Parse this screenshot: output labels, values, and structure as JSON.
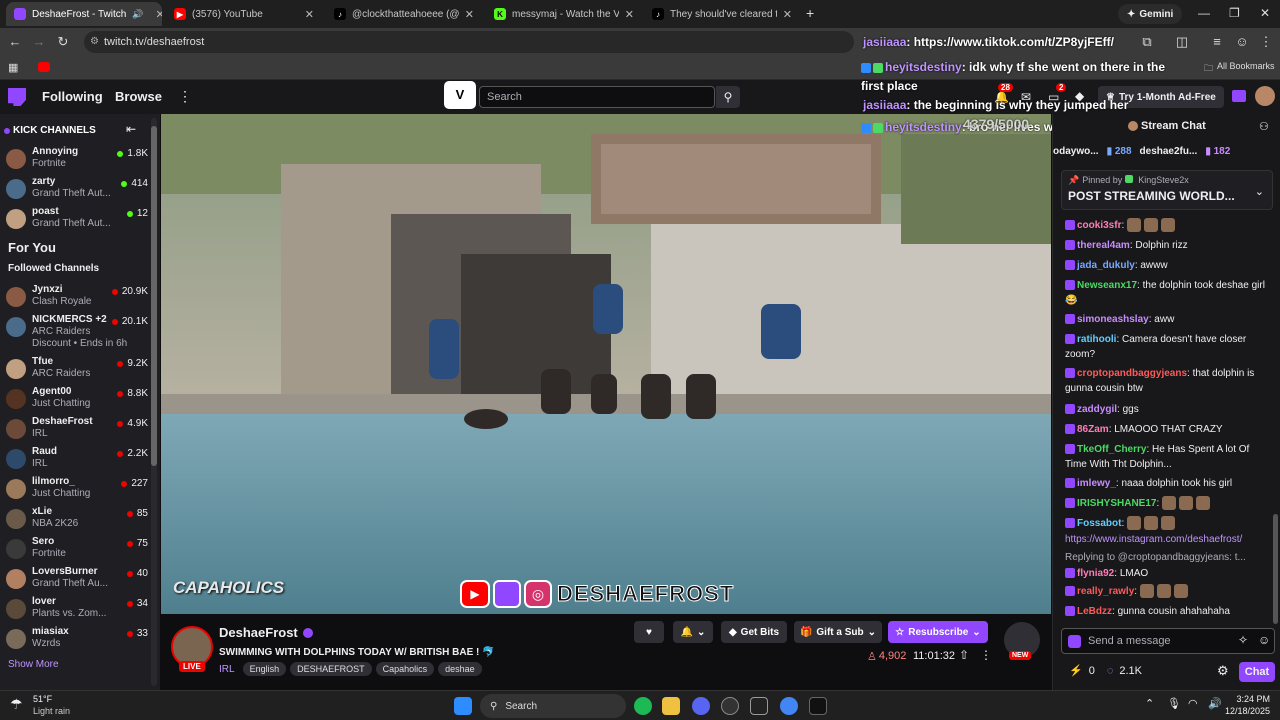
{
  "browser": {
    "tabs": [
      {
        "title": "DeshaeFrost - Twitch",
        "active": true
      },
      {
        "title": "(3576) YouTube"
      },
      {
        "title": "@clockthatteahoeee (@clockth"
      },
      {
        "title": "messymaj - Watch the VOD on"
      },
      {
        "title": "They should've cleared the hou"
      }
    ],
    "url": "twitch.tv/deshaefrost",
    "gemini_label": "Gemini",
    "all_bookmarks": "All Bookmarks"
  },
  "twitch_nav": {
    "following": "Following",
    "browse": "Browse",
    "search_placeholder": "Search",
    "notif_count": "28",
    "inbox_count": "2",
    "ad_free": "Try 1-Month Ad-Free"
  },
  "sidebar": {
    "kick_title": "KICK CHANNELS",
    "kick": [
      {
        "name": "Annoying",
        "game": "Fortnite",
        "viewers": "1.8K"
      },
      {
        "name": "zarty",
        "game": "Grand Theft Aut...",
        "viewers": "414"
      },
      {
        "name": "poast",
        "game": "Grand Theft Aut...",
        "viewers": "12"
      }
    ],
    "for_you": "For You",
    "followed_title": "Followed Channels",
    "followed": [
      {
        "name": "Jynxzi",
        "game": "Clash Royale",
        "viewers": "20.9K"
      },
      {
        "name": "NICKMERCS +2",
        "game": "ARC Raiders",
        "viewers": "20.1K",
        "extra": "Discount • Ends in 6h"
      },
      {
        "name": "Tfue",
        "game": "ARC Raiders",
        "viewers": "9.2K"
      },
      {
        "name": "Agent00",
        "game": "Just Chatting",
        "viewers": "8.8K"
      },
      {
        "name": "DeshaeFrost",
        "game": "IRL",
        "viewers": "4.9K"
      },
      {
        "name": "Raud",
        "game": "IRL",
        "viewers": "2.2K"
      },
      {
        "name": "lilmorro_",
        "game": "Just Chatting",
        "viewers": "227"
      },
      {
        "name": "xLie",
        "game": "NBA 2K26",
        "viewers": "85"
      },
      {
        "name": "Sero",
        "game": "Fortnite",
        "viewers": "75"
      },
      {
        "name": "LoversBurner",
        "game": "Grand Theft Au...",
        "viewers": "40"
      },
      {
        "name": "lover",
        "game": "Plants vs. Zom...",
        "viewers": "34"
      },
      {
        "name": "miasiax",
        "game": "Wzrds",
        "viewers": "33"
      }
    ],
    "show_more": "Show More"
  },
  "video": {
    "watermark": "CAPAHOLICS",
    "brand": "DESHAEFROST"
  },
  "overlay_chat": [
    {
      "user": "jasiiaaa",
      "text": ": https://www.tiktok.com/t/ZP8yjFEff/"
    },
    {
      "user": "heyitsdestiny",
      "text": ": idk why tf she went on there in the first place"
    },
    {
      "user": "jasiiaaa",
      "text": ": the beginning is why they jumped her"
    },
    {
      "user": "heyitsdestiny",
      "text": ": bro her lives was few funny"
    }
  ],
  "overlay_goal": "4379/5000",
  "stream": {
    "name": "DeshaeFrost",
    "title": "SWIMMING WITH DOLPHINS TODAY W/ BRITISH BAE ! 🐬",
    "category": "IRL",
    "tags": [
      "English",
      "DESHAEFROST",
      "Capaholics",
      "deshae"
    ],
    "live": "LIVE",
    "viewers": "4,902",
    "uptime": "11:01:32",
    "get_bits": "Get Bits",
    "gift_sub": "Gift a Sub",
    "resubscribe": "Resubscribe",
    "new_badge": "NEW"
  },
  "chat": {
    "title": "Stream Chat",
    "hype_users": [
      {
        "name": "odaywo...",
        "count": "288"
      },
      {
        "name": "deshae2fu...",
        "count": "182"
      }
    ],
    "pinned_by": "Pinned by",
    "pinned_user": "KingSteve2x",
    "pinned_text": "POST STREAMING WORLD...",
    "messages": [
      {
        "user": "cooki3sfr",
        "color": "#ff7eb6",
        "text": ""
      },
      {
        "user": "thereal4am",
        "color": "#c88cff",
        "text": "Dolphin rizz"
      },
      {
        "user": "jada_dukuly",
        "color": "#7aa8ff",
        "text": "awww"
      },
      {
        "user": "Newseanx17",
        "color": "#4cd964",
        "text": "the dolphin took deshae girl 😂"
      },
      {
        "user": "simoneashslay",
        "color": "#c88cff",
        "text": "aww"
      },
      {
        "user": "ratihooli",
        "color": "#5fd0ff",
        "text": "Camera doesn't have closer zoom?"
      },
      {
        "user": "croptopandbaggyjeans",
        "color": "#ff5a5a",
        "text": "that dolphin is gunna cousin btw"
      },
      {
        "user": "zaddygil",
        "color": "#c88cff",
        "text": "ggs"
      },
      {
        "user": "86Zam",
        "color": "#ff7eb6",
        "text": "LMAOOO THAT CRAZY"
      },
      {
        "user": "TkeOff_Cherry",
        "color": "#4cd964",
        "text": "He Has Spent A lot Of Time With Tht Dolphin..."
      },
      {
        "user": "imlewy_",
        "color": "#c88cff",
        "text": "naaa dolphin took his girl"
      },
      {
        "user": "IRISHYSHANE17",
        "color": "#4cd964",
        "text": ""
      },
      {
        "user": "Fossabot",
        "color": "#5fd0ff",
        "text": ""
      },
      {
        "user": "",
        "color": "#adadb8",
        "text": "https://www.instagram.com/deshaefrost/"
      },
      {
        "user": "",
        "color": "#adadb8",
        "text": "Replying to @croptopandbaggyjeans: t..."
      },
      {
        "user": "flynia92",
        "color": "#ff7eb6",
        "text": "LMAO"
      },
      {
        "user": "really_rawly",
        "color": "#ff5a5a",
        "text": ""
      },
      {
        "user": "LeBdzz",
        "color": "#ff5a5a",
        "text": "gunna cousin ahahahaha"
      }
    ],
    "send_placeholder": "Send a message",
    "points": "0",
    "points2": "2.1K",
    "chat_button": "Chat"
  },
  "taskbar": {
    "temp": "51°F",
    "weather": "Light rain",
    "search": "Search",
    "time": "3:24 PM",
    "date": "12/18/2025"
  }
}
